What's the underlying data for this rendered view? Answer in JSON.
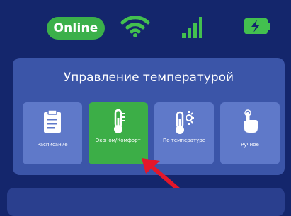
{
  "status": {
    "connection_label": "Online",
    "wifi_icon": "wifi-icon",
    "signal_icon": "cell-signal-icon",
    "battery_icon": "battery-charging-icon"
  },
  "temperature_panel": {
    "title": "Управление температурой",
    "modes": [
      {
        "label": "Расписание",
        "icon": "schedule-clipboard-icon",
        "active": false
      },
      {
        "label": "Эконом/Комфорт",
        "icon": "thermometer-icon",
        "active": true
      },
      {
        "label": "По температуре",
        "icon": "thermometer-sun-icon",
        "active": false
      },
      {
        "label": "Ручное",
        "icon": "hand-pointer-icon",
        "active": false
      }
    ]
  },
  "colors": {
    "background": "#14266c",
    "panel": "#3b55a8",
    "tile": "#5f79c9",
    "active_tile": "#3cae47",
    "online": "#3bb04a",
    "annotation_arrow": "#e3172a"
  }
}
